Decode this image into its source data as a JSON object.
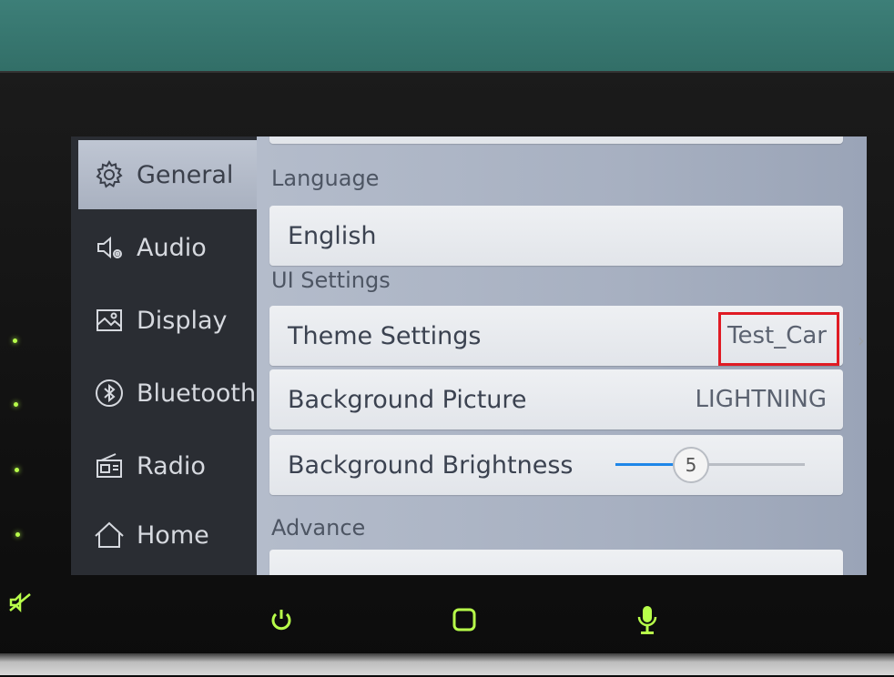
{
  "sidebar": {
    "items": [
      {
        "label": "General",
        "icon": "gear-icon"
      },
      {
        "label": "Audio",
        "icon": "speaker-icon"
      },
      {
        "label": "Display",
        "icon": "display-icon"
      },
      {
        "label": "Bluetooth",
        "icon": "bluetooth-icon"
      },
      {
        "label": "Radio",
        "icon": "radio-icon"
      },
      {
        "label": "Home",
        "icon": "home-icon"
      }
    ]
  },
  "content": {
    "language_section": "Language",
    "language_value": "English",
    "ui_section": "UI Settings",
    "theme_label": "Theme Settings",
    "theme_value": "Test_Car",
    "bg_picture_label": "Background Picture",
    "bg_picture_value": "LIGHTNING",
    "brightness_label": "Background Brightness",
    "brightness_value": "5",
    "brightness_fraction": 0.4,
    "advance_section": "Advance"
  },
  "colors": {
    "led": "#b8ff4a",
    "highlight": "#e01b24",
    "slider": "#1e86e8"
  }
}
